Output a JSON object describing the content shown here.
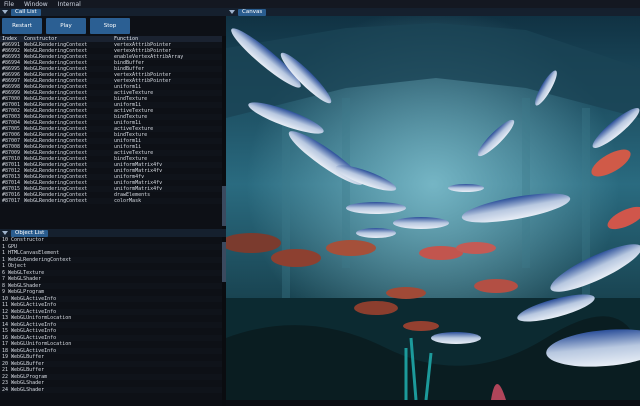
{
  "menubar": [
    "File",
    "Window",
    "Internal"
  ],
  "call_list": {
    "title": "Call List",
    "buttons": [
      "Restart",
      "Play",
      "Stop"
    ],
    "columns": [
      "Index",
      "Constructor",
      "Function"
    ],
    "rows": [
      [
        "#86991",
        "WebGLRenderingContext",
        "vertexAttribPointer"
      ],
      [
        "#86992",
        "WebGLRenderingContext",
        "vertexAttribPointer"
      ],
      [
        "#86993",
        "WebGLRenderingContext",
        "enableVertexAttribArray"
      ],
      [
        "#86994",
        "WebGLRenderingContext",
        "bindBuffer"
      ],
      [
        "#86995",
        "WebGLRenderingContext",
        "bindBuffer"
      ],
      [
        "#86996",
        "WebGLRenderingContext",
        "vertexAttribPointer"
      ],
      [
        "#86997",
        "WebGLRenderingContext",
        "vertexAttribPointer"
      ],
      [
        "#86998",
        "WebGLRenderingContext",
        "uniform1i"
      ],
      [
        "#86999",
        "WebGLRenderingContext",
        "activeTexture"
      ],
      [
        "#87000",
        "WebGLRenderingContext",
        "bindTexture"
      ],
      [
        "#87001",
        "WebGLRenderingContext",
        "uniform1i"
      ],
      [
        "#87002",
        "WebGLRenderingContext",
        "activeTexture"
      ],
      [
        "#87003",
        "WebGLRenderingContext",
        "bindTexture"
      ],
      [
        "#87004",
        "WebGLRenderingContext",
        "uniform1i"
      ],
      [
        "#87005",
        "WebGLRenderingContext",
        "activeTexture"
      ],
      [
        "#87006",
        "WebGLRenderingContext",
        "bindTexture"
      ],
      [
        "#87007",
        "WebGLRenderingContext",
        "uniform1i"
      ],
      [
        "#87008",
        "WebGLRenderingContext",
        "uniform1i"
      ],
      [
        "#87009",
        "WebGLRenderingContext",
        "activeTexture"
      ],
      [
        "#87010",
        "WebGLRenderingContext",
        "bindTexture"
      ],
      [
        "#87011",
        "WebGLRenderingContext",
        "uniformMatrix4fv"
      ],
      [
        "#87012",
        "WebGLRenderingContext",
        "uniformMatrix4fv"
      ],
      [
        "#87013",
        "WebGLRenderingContext",
        "uniform4fv"
      ],
      [
        "#87014",
        "WebGLRenderingContext",
        "uniformMatrix4fv"
      ],
      [
        "#87015",
        "WebGLRenderingContext",
        "uniformMatrix4fv"
      ],
      [
        "#87016",
        "WebGLRenderingContext",
        "drawElements"
      ],
      [
        "#87017",
        "WebGLRenderingContext",
        "colorMask"
      ]
    ]
  },
  "object_list": {
    "title": "Object List",
    "items": [
      "10 Constructor",
      "1 GPU",
      "1 HTMLCanvasElement",
      "1 WebGLRenderingContext",
      "1 Object",
      "6 WebGLTexture",
      "7 WebGLShader",
      "8 WebGLShader",
      "9 WebGLProgram",
      "10 WebGLActiveInfo",
      "11 WebGLActiveInfo",
      "12 WebGLActiveInfo",
      "13 WebGLUniformLocation",
      "14 WebGLActiveInfo",
      "15 WebGLActiveInfo",
      "16 WebGLActiveInfo",
      "17 WebGLUniformLocation",
      "18 WebGLActiveInfo",
      "19 WebGLBuffer",
      "20 WebGLBuffer",
      "21 WebGLBuffer",
      "22 WebGLProgram",
      "23 WebGLShader",
      "24 WebGLShader"
    ]
  },
  "canvas": {
    "title": "Canvas"
  }
}
